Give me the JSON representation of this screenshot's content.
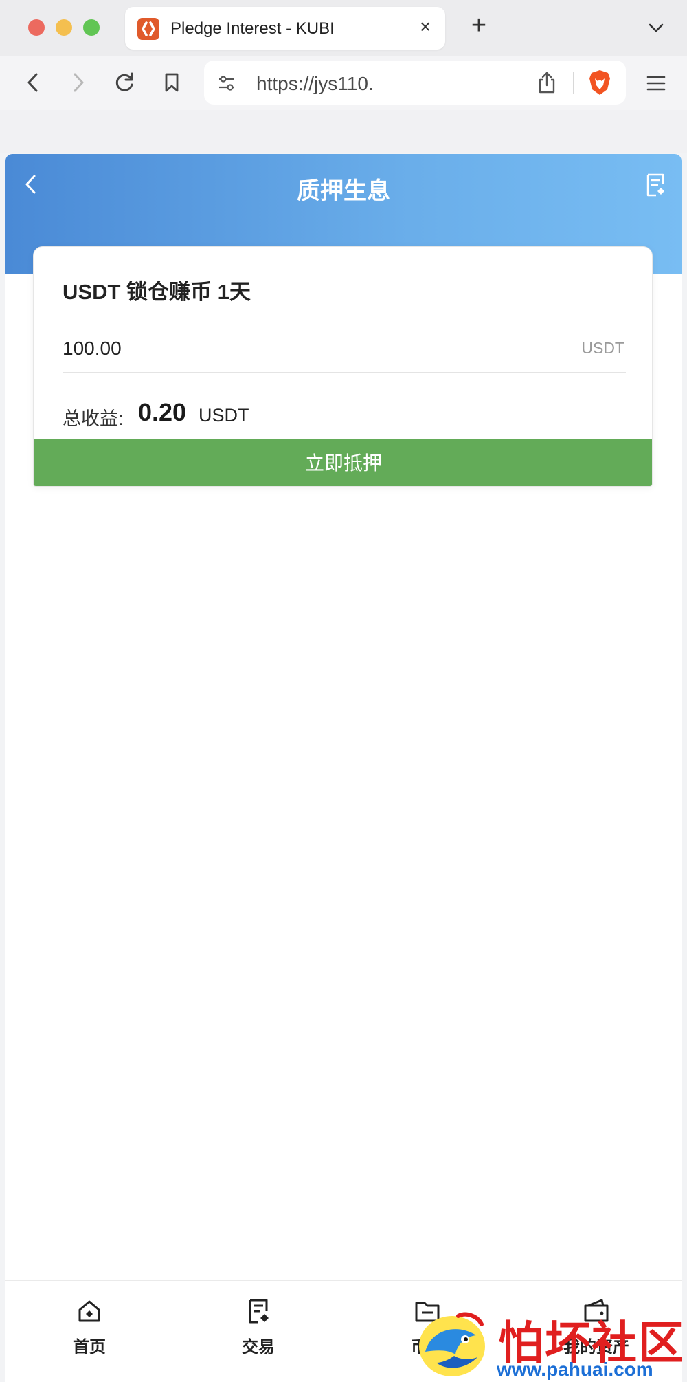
{
  "browser": {
    "tab_title": "Pledge Interest - KUBI",
    "tab_close": "×",
    "new_tab": "+",
    "url": "https://jys110."
  },
  "header": {
    "title": "质押生息"
  },
  "card": {
    "title": "USDT 锁仓赚币 1天",
    "amount_value": "100.00",
    "amount_unit": "USDT",
    "earnings_label": "总收益:",
    "earnings_value": "0.20",
    "earnings_unit": "USDT",
    "submit_label": "立即抵押"
  },
  "bottom_nav": {
    "items": [
      {
        "label": "首页",
        "icon": "home-icon"
      },
      {
        "label": "交易",
        "icon": "trade-icon"
      },
      {
        "label": "币币",
        "icon": "coin-icon"
      },
      {
        "label": "我的资产",
        "icon": "wallet-icon"
      }
    ]
  },
  "watermark": {
    "text": "怕坏社区",
    "url": "www.pahuai.com"
  },
  "colors": {
    "header_gradient_start": "#4a8ad6",
    "header_gradient_end": "#78bdf3",
    "pledge_button": "#63ab58",
    "watermark_red": "#e01f1f",
    "watermark_blue": "#1c6fd6"
  }
}
